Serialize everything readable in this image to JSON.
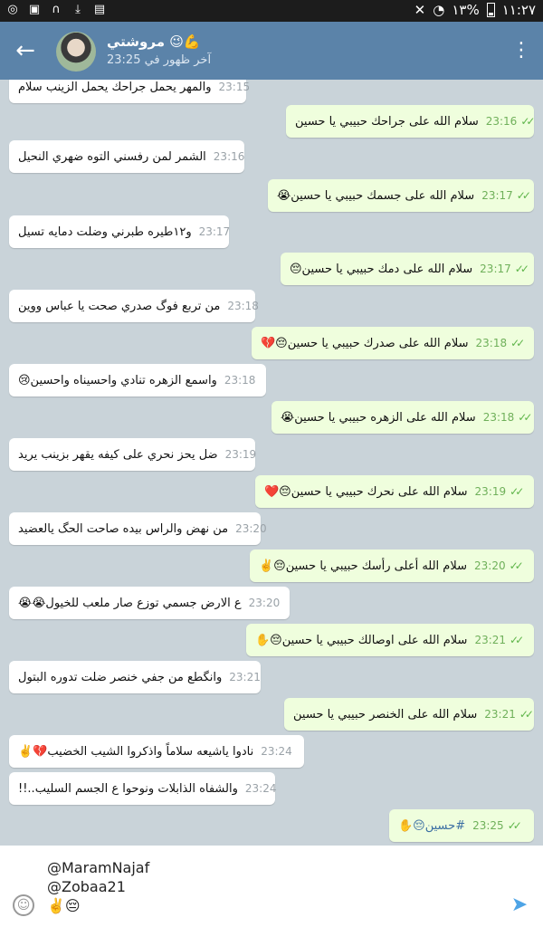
{
  "status_bar": {
    "time": "١١:٢٧",
    "battery_percent": "١٣%",
    "icons": [
      "whatsapp-icon",
      "image-icon",
      "headphones-icon",
      "download-icon",
      "briefcase-icon"
    ]
  },
  "header": {
    "back_icon": "arrow-left-icon",
    "name": "مروشتي 😉💪",
    "last_seen": "آخر ظهور في 23:25",
    "menu_icon": "more-vert-icon"
  },
  "messages": [
    {
      "dir": "in",
      "text": "والمهر يحمل جراحك يحمل الزينب سلام",
      "time": "23:15"
    },
    {
      "dir": "out",
      "text": "سلام الله على جراحك حبيبي يا حسين",
      "time": "23:16"
    },
    {
      "dir": "in",
      "text": "الشمر لمن رفسني التوه ضهري النحيل",
      "time": "23:16"
    },
    {
      "dir": "out",
      "text": "سلام الله على جسمك حبيبي يا حسين😭",
      "time": "23:17"
    },
    {
      "dir": "in",
      "text": "و١٢طيره طبرني وضلت دمايه تسيل",
      "time": "23:17"
    },
    {
      "dir": "out",
      "text": "سلام الله على دمك حبيبي يا حسين😔",
      "time": "23:17"
    },
    {
      "dir": "in",
      "text": "من تربع فوگ صدري صحت يا عباس ووين",
      "time": "23:18"
    },
    {
      "dir": "out",
      "text": "سلام الله على صدرك حبيبي يا حسين😔💔",
      "time": "23:18"
    },
    {
      "dir": "in",
      "text": "واسمع الزهره تنادي واحسيناه واحسين😢",
      "time": "23:18"
    },
    {
      "dir": "out",
      "text": "سلام الله على الزهره حبيبي يا حسين😭",
      "time": "23:18"
    },
    {
      "dir": "in",
      "text": "ضل يحز نحري على كيفه يقهر بزينب يريد",
      "time": "23:19"
    },
    {
      "dir": "out",
      "text": "سلام الله على نحرك حبيبي يا حسين😔❤️",
      "time": "23:19"
    },
    {
      "dir": "in",
      "text": "من نهض والراس بيده صاحت الحگ يالعضيد",
      "time": "23:20"
    },
    {
      "dir": "out",
      "text": "سلام الله أعلى رأسك حبيبي يا حسين😔✌️",
      "time": "23:20"
    },
    {
      "dir": "in",
      "text": "ع الارض جسمي توزع صار ملعب للخيول😭😭",
      "time": "23:20"
    },
    {
      "dir": "out",
      "text": "سلام الله على اوصالك حبيبي يا حسين😔✋",
      "time": "23:21"
    },
    {
      "dir": "in",
      "text": "وانگطع من جفي خنصر ضلت تدوره البتول",
      "time": "23:21"
    },
    {
      "dir": "out",
      "text": "سلام الله على الخنصر حبيبي يا حسين",
      "time": "23:21"
    },
    {
      "dir": "in",
      "text": "نادوا ياشيعه سلاماً واذكروا الشيب الخضيب💔✌️",
      "time": "23:24"
    },
    {
      "dir": "in",
      "text": "والشفاه الذابلات ونوحوا ع الجسم السليب..!!",
      "time": "23:24"
    },
    {
      "dir": "out",
      "text": "#حسين😔✋",
      "time": "23:25"
    }
  ],
  "composer": {
    "lines": [
      "@MaramNajaf",
      "@Zobaa21",
      "✌️😔"
    ],
    "emoji_icon": "smile-icon",
    "send_icon": "send-icon"
  }
}
